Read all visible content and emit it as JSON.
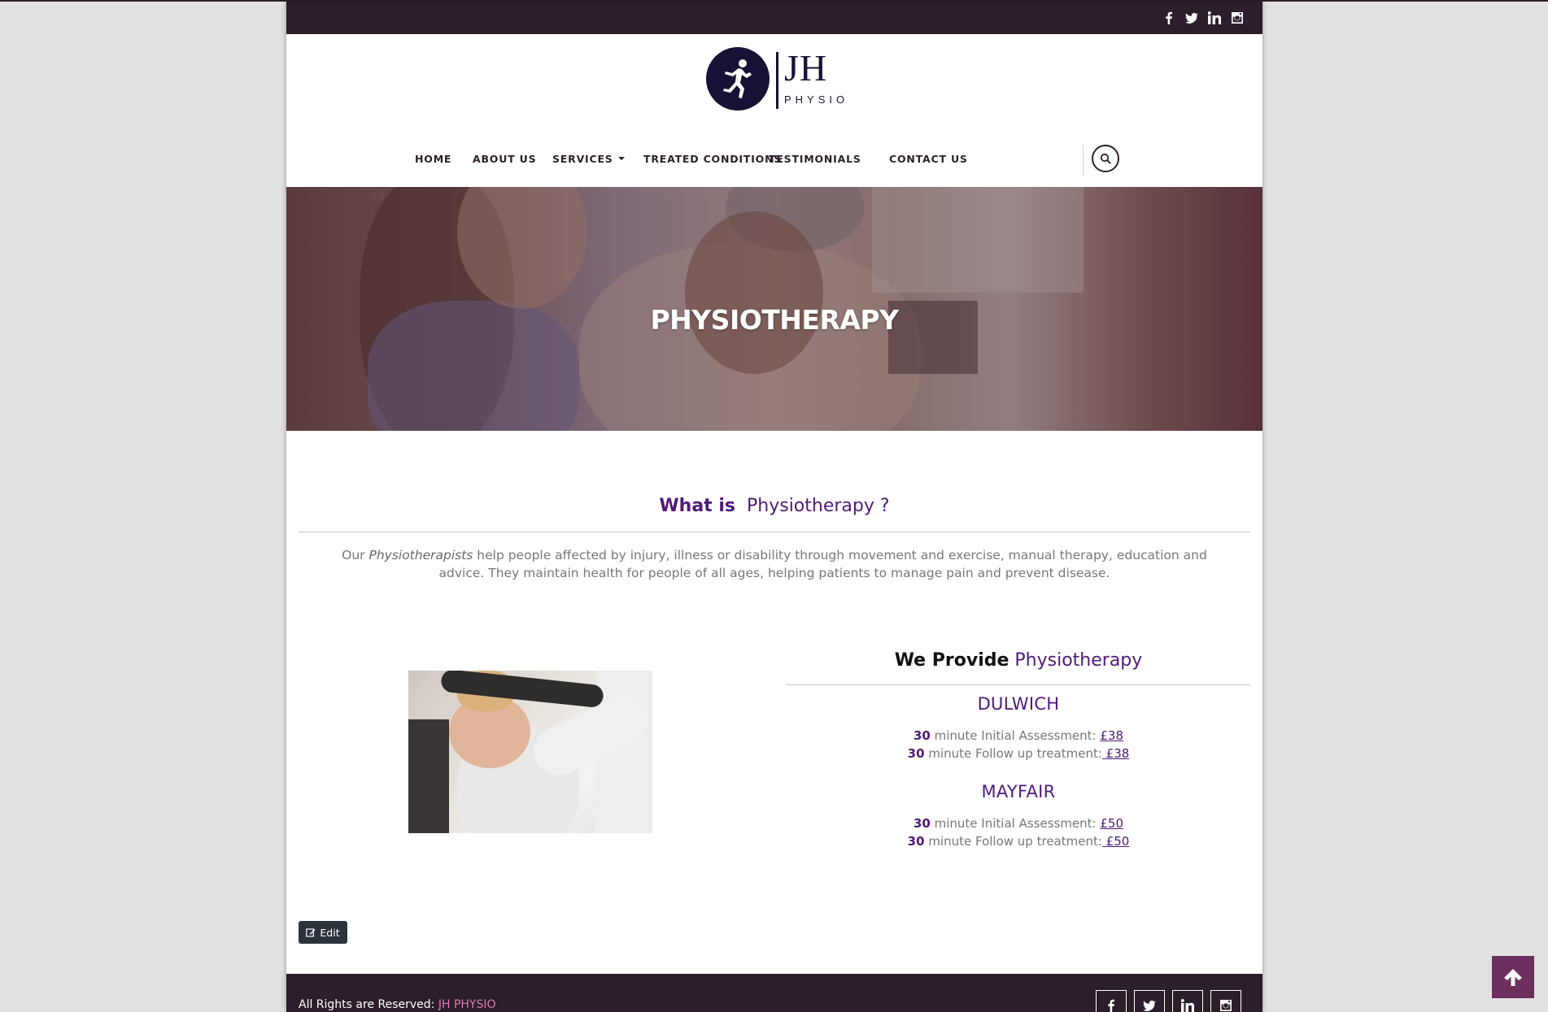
{
  "top_social": [
    "facebook-icon",
    "twitter-icon",
    "linkedin-icon",
    "instagram-icon"
  ],
  "logo": {
    "mark": "JH",
    "sub": "PHYSIO"
  },
  "nav": {
    "home": "HOME",
    "about": "ABOUT US",
    "services": "SERVICES",
    "treated": "TREATED CONDITIONS",
    "testimonials": "TESTIMONIALS",
    "contact": "CONTACT US"
  },
  "hero": {
    "title": "PHYSIOTHERAPY"
  },
  "whatis": {
    "bold": "What is",
    "rest": "Physiotherapy",
    "q": "?"
  },
  "intro": {
    "pre": "Our ",
    "italic": "Physiotherapists",
    "post": " help people affected by injury, illness or disability through movement and exercise, manual therapy, education and advice. They maintain health for people of all ages, helping patients to manage pain and prevent disease."
  },
  "provide": {
    "bold": "We Provide",
    "rest": "Physiotherapy"
  },
  "locations": [
    {
      "name": "DULWICH",
      "lines": [
        {
          "num": "30",
          "text": " minute Initial Assessment: ",
          "price": "£38"
        },
        {
          "num": "30",
          "text": " minute Follow up treatment:",
          "price": " £38"
        }
      ]
    },
    {
      "name": "MAYFAIR",
      "lines": [
        {
          "num": "30",
          "text": " minute Initial Assessment: ",
          "price": "£50"
        },
        {
          "num": "30",
          "text": " minute Follow up treatment:",
          "price": " £50"
        }
      ]
    }
  ],
  "edit_label": "Edit",
  "footer": {
    "copy": "All Rights are Reserved: ",
    "brand": "JH PHYSIO"
  },
  "colors": {
    "accent": "#4f1a78",
    "dark": "#2c1e2b",
    "totop": "#6d2f5e"
  }
}
